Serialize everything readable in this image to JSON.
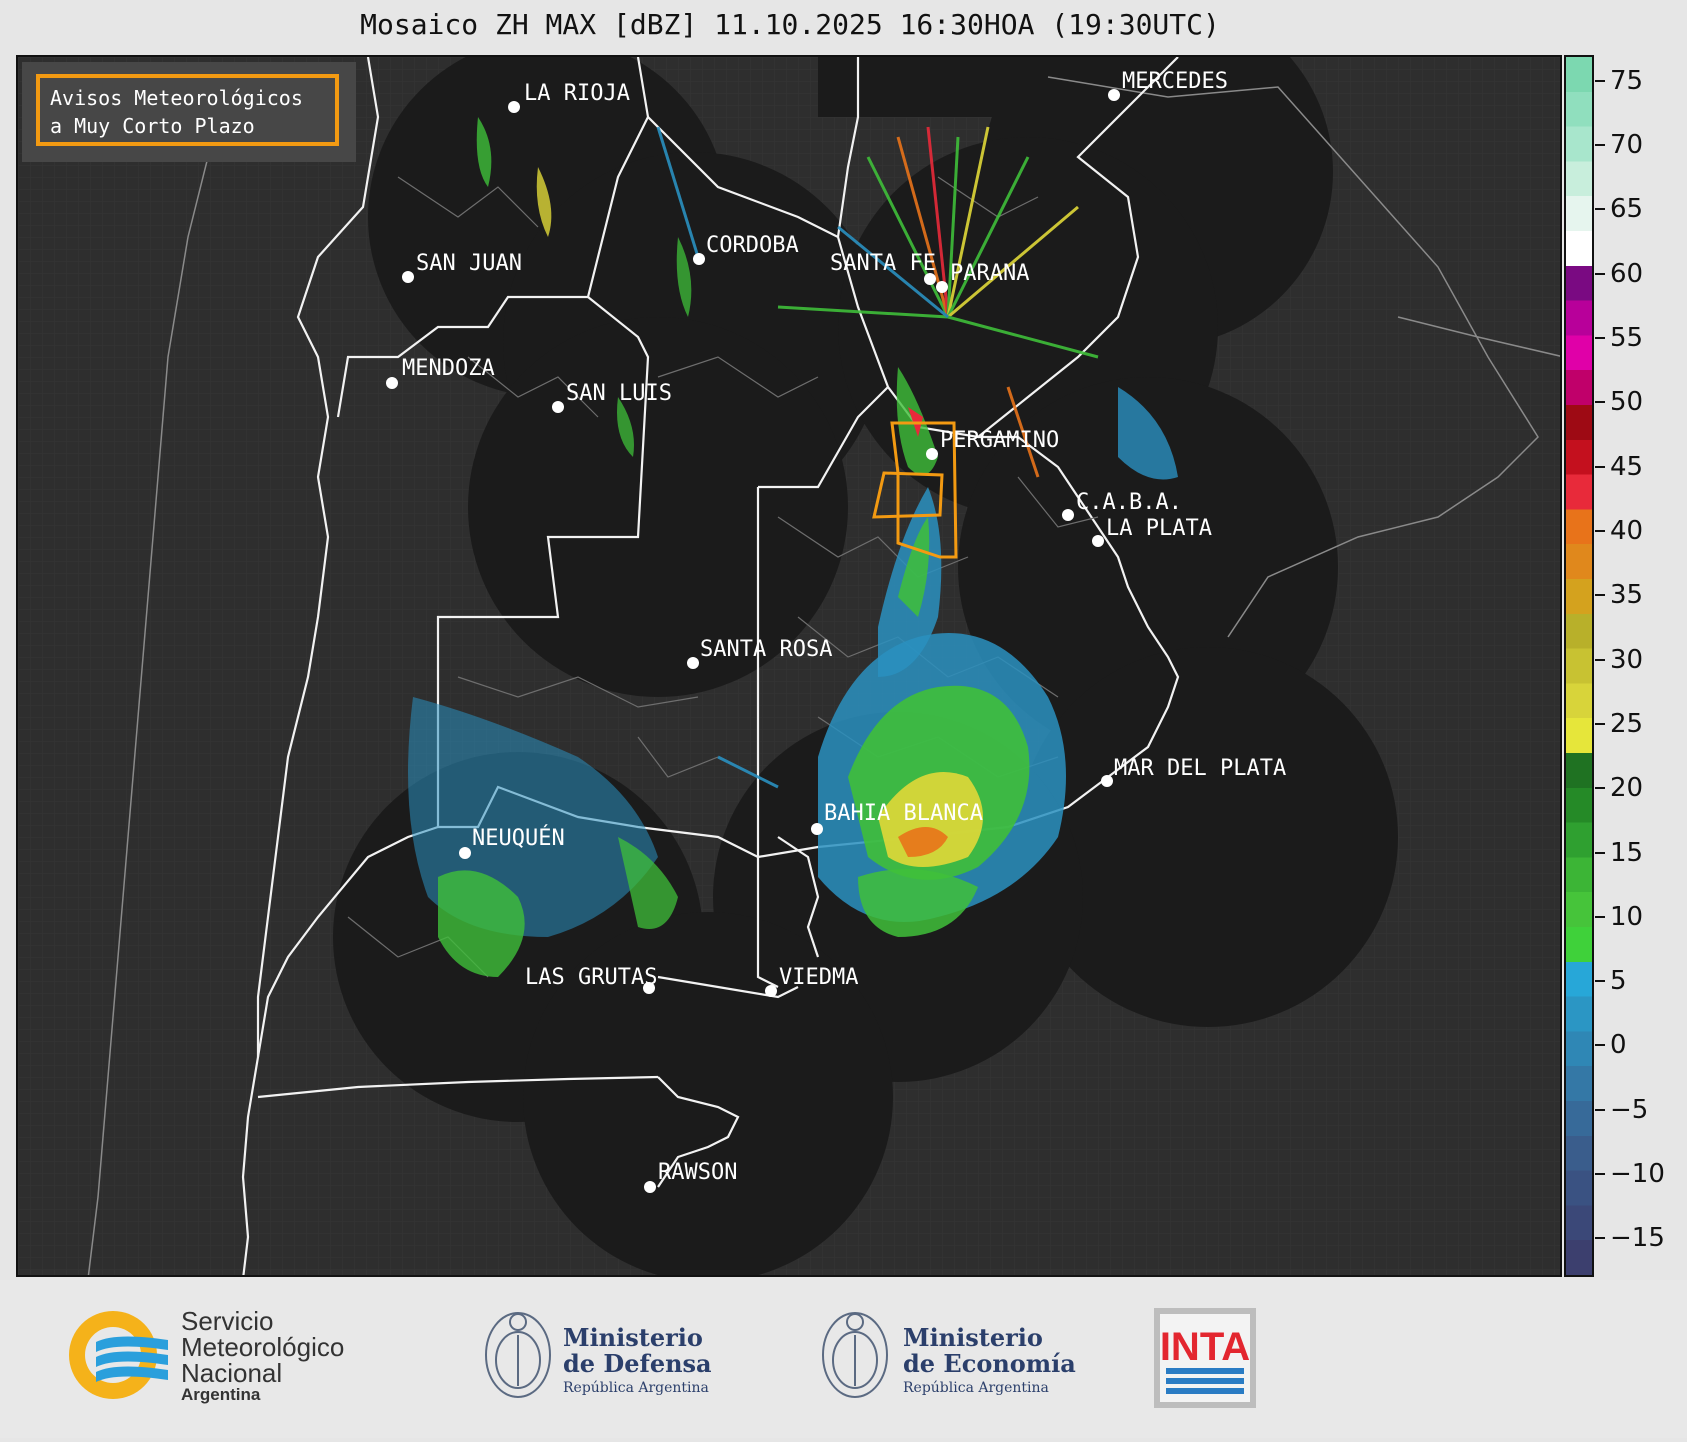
{
  "title": "Mosaico ZH MAX [dBZ] 11.10.2025 16:30HOA (19:30UTC)",
  "legend": {
    "line1": "Avisos Meteorológicos",
    "line2": "a Muy Corto Plazo",
    "border_color": "#f39a12"
  },
  "cities": {
    "la_rioja": "LA RIOJA",
    "mercedes": "MERCEDES",
    "san_juan": "SAN JUAN",
    "cordoba": "CORDOBA",
    "santa_fe": "SANTA FE",
    "parana": "PARANA",
    "mendoza": "MENDOZA",
    "san_luis": "SAN LUIS",
    "pergamino": "PERGAMINO",
    "caba": "C.A.B.A.",
    "la_plata": "LA PLATA",
    "santa_rosa": "SANTA ROSA",
    "mar_del_plata": "MAR DEL PLATA",
    "bahia_blanca": "BAHIA BLANCA",
    "neuquen": "NEUQUÉN",
    "las_grutas": "LAS GRUTAS",
    "viedma": "VIEDMA",
    "rawson": "RAWSON"
  },
  "colorbar": {
    "ticks": [
      "75",
      "70",
      "65",
      "60",
      "55",
      "50",
      "45",
      "40",
      "35",
      "30",
      "25",
      "20",
      "15",
      "10",
      "5",
      "0",
      "−5",
      "−10",
      "−15"
    ],
    "min": -18,
    "max": 77,
    "colors": [
      "#3c3f6e",
      "#3b4878",
      "#3a5282",
      "#3a5d8c",
      "#376a99",
      "#3478a6",
      "#2f87b5",
      "#2b96c4",
      "#27a7d8",
      "#3fd13a",
      "#46c43a",
      "#3cb536",
      "#2fa030",
      "#258a27",
      "#1f7222",
      "#e6e63a",
      "#d8d43a",
      "#c8c232",
      "#b8b02a",
      "#d4a21e",
      "#e0881c",
      "#e8731a",
      "#e82a3a",
      "#c4101e",
      "#9e0a14",
      "#c0006a",
      "#e000a8",
      "#b8009a",
      "#7a0a82",
      "#ffffff",
      "#e6f5ee",
      "#c8eedc",
      "#a8e6cc",
      "#90dfbe",
      "#7cd8b0"
    ]
  },
  "footer": {
    "smn_l1": "Servicio",
    "smn_l2": "Meteorológico",
    "smn_l3": "Nacional",
    "smn_l4": "Argentina",
    "def_l1": "Ministerio",
    "def_l2": "de Defensa",
    "def_l3": "República Argentina",
    "eco_l1": "Ministerio",
    "eco_l2": "de Economía",
    "eco_l3": "República Argentina",
    "inta": "INTA"
  }
}
